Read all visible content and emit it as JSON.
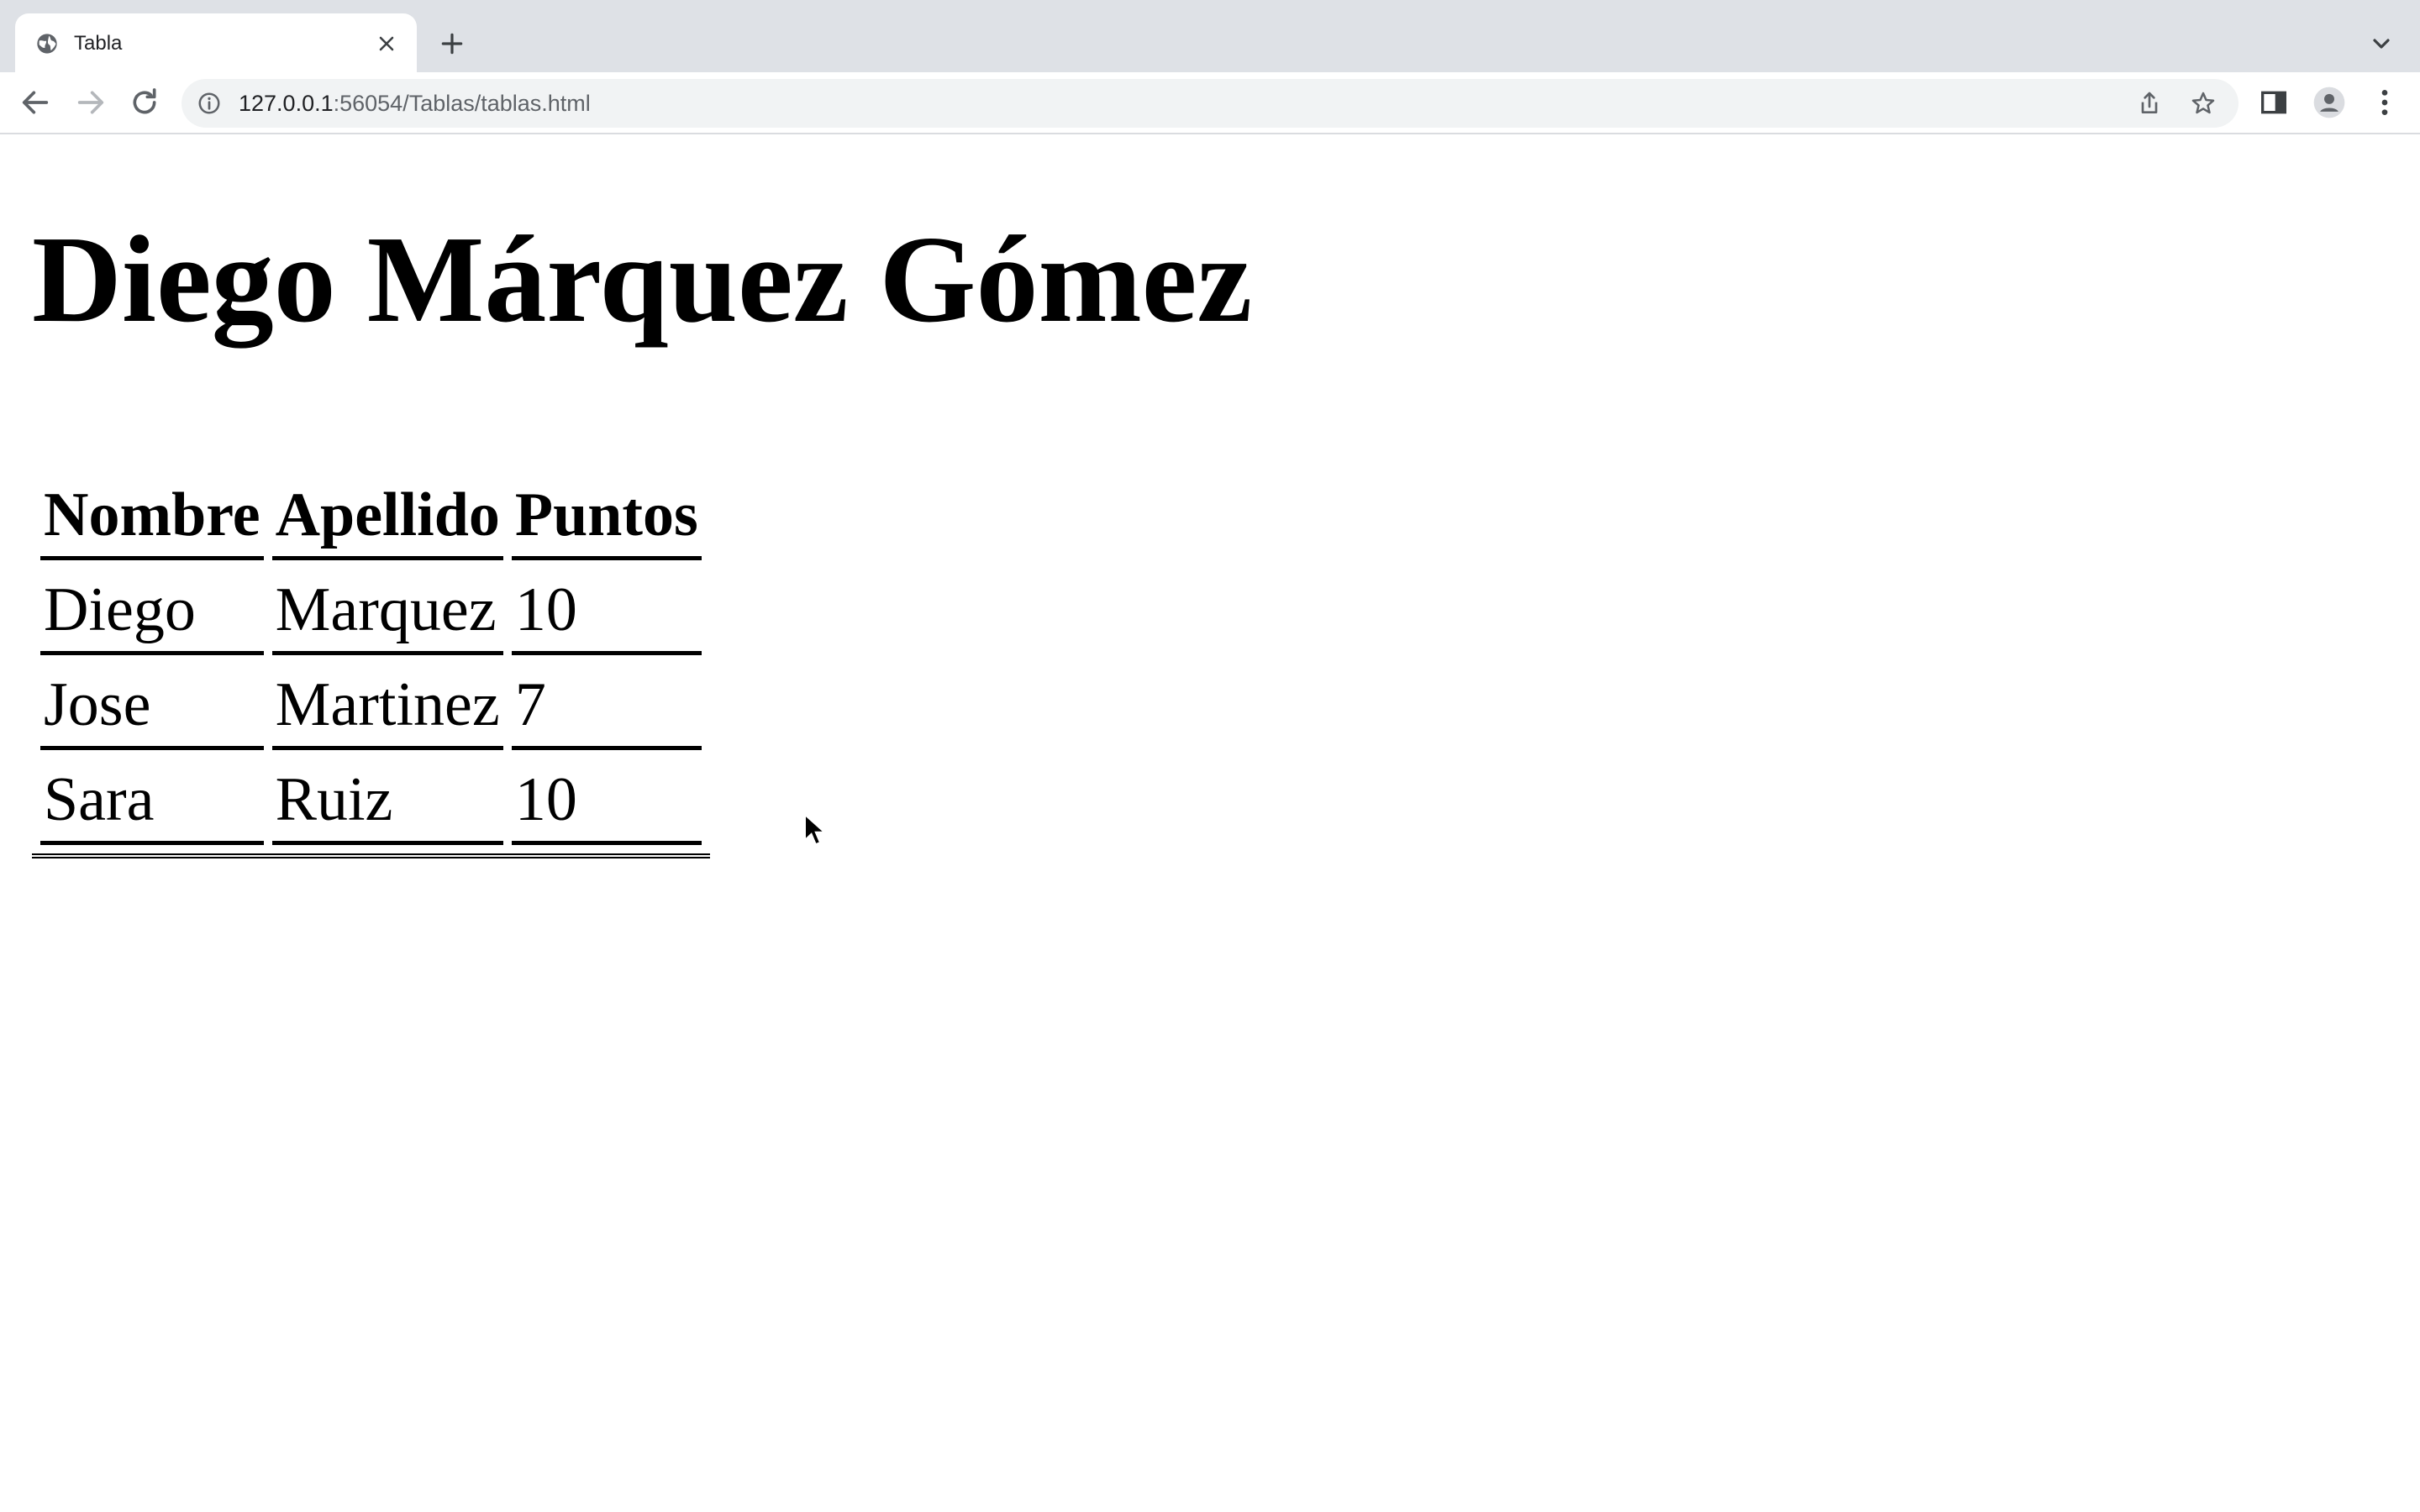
{
  "browser": {
    "tab": {
      "title": "Tabla"
    },
    "omnibox": {
      "url_host": "127.0.0.1",
      "url_rest": ":56054/Tablas/tablas.html"
    }
  },
  "icons": {
    "tab_favicon": "globe-icon",
    "tab_close": "close-icon",
    "new_tab": "plus-icon",
    "tab_search": "chevron-down-icon",
    "back": "arrow-left-icon",
    "forward": "arrow-right-icon",
    "reload": "reload-icon",
    "site_info": "info-icon",
    "share": "share-icon",
    "bookmark": "star-icon",
    "side_panel": "side-panel-icon",
    "profile": "profile-icon",
    "menu": "kebab-menu-icon"
  },
  "page": {
    "heading": "Diego Márquez Gómez",
    "table": {
      "headers": [
        "Nombre",
        "Apellido",
        "Puntos"
      ],
      "rows": [
        [
          "Diego",
          "Marquez",
          "10"
        ],
        [
          "Jose",
          "Martinez",
          "7"
        ],
        [
          "Sara",
          "Ruiz",
          "10"
        ]
      ]
    }
  }
}
